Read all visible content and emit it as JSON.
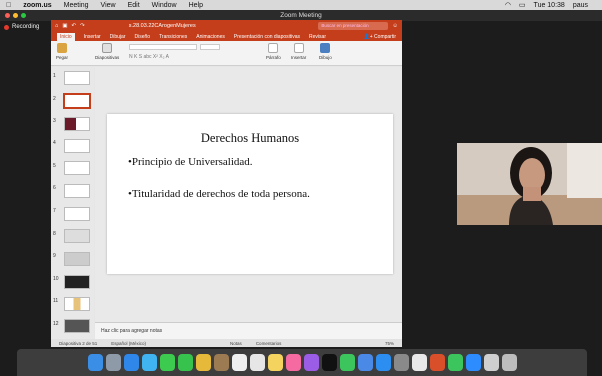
{
  "menubar": {
    "app": "zoom.us",
    "items": [
      "Meeting",
      "View",
      "Edit",
      "Window",
      "Help"
    ],
    "time": "Tue 10:38",
    "user": "paus"
  },
  "zoom": {
    "title": "Zoom Meeting",
    "recording": "Recording"
  },
  "ppt": {
    "doc_title": "s.28.03.22CArogenMujeres",
    "search_placeholder": "Buscar en presentación",
    "tabs": [
      "Inicio",
      "Insertar",
      "Dibujar",
      "Diseño",
      "Transiciones",
      "Animaciones",
      "Presentación con diapositivas",
      "Revisar"
    ],
    "share": "Compartir",
    "ribbon": {
      "paste": "Pegar",
      "slides": "Diapositivas",
      "paragraph": "Párrafo",
      "insert": "Insertar",
      "draw": "Dibujo"
    },
    "thumb_numbers": [
      "1",
      "2",
      "3",
      "4",
      "5",
      "6",
      "7",
      "8",
      "9",
      "10",
      "11",
      "12"
    ],
    "slide": {
      "title": "Derechos Humanos",
      "bullet1": "•Principio de Universalidad.",
      "bullet2": "•Titularidad de derechos de toda persona."
    },
    "notes_placeholder": "Haz clic para agregar notas",
    "status": {
      "slide_counter": "Diapositiva 2 de 51",
      "language": "Español (México)",
      "notes": "Notas",
      "comments": "Comentarios",
      "zoom": "75%"
    }
  },
  "colors": {
    "ppt_accent": "#c43e1c",
    "recording": "#e23b2e"
  }
}
